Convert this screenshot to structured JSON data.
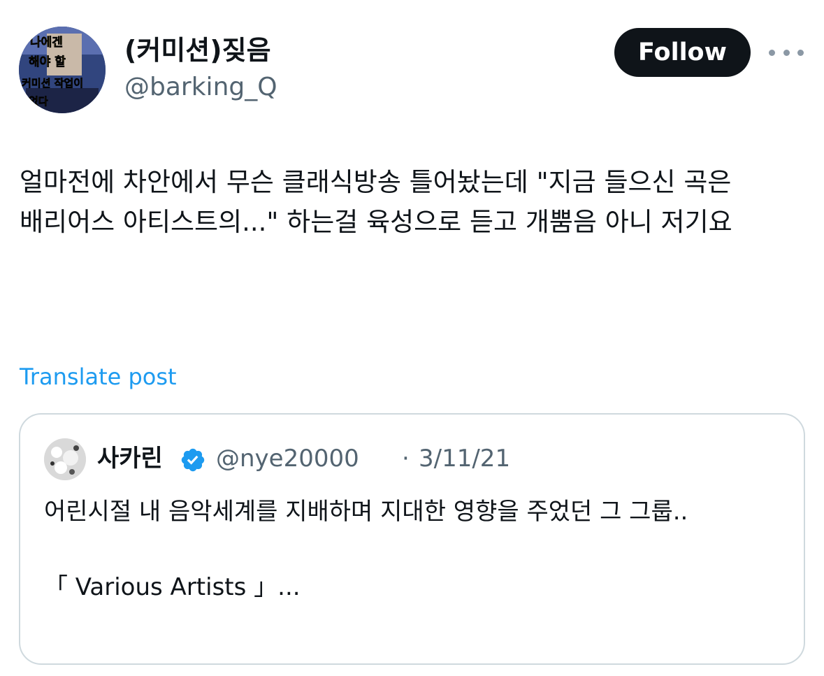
{
  "author": {
    "display_name": "(커미션)짖음",
    "handle": "@barking_Q",
    "avatar_text": [
      "나에겐",
      "해야 할",
      "커미션 작업이",
      "없다"
    ]
  },
  "follow_label": "Follow",
  "post": {
    "text": "얼마전에 차안에서 무슨 클래식방송 틀어놨는데 \"지금 들으신 곡은 배리어스 아티스트의...\" 하는걸 육성으로 듣고 개뿜음 아니 저기요"
  },
  "translate_label": "Translate post",
  "quote": {
    "display_name": "사카린",
    "handle": "@nye20000",
    "separator": "·",
    "date": "3/11/21",
    "text": "어린시절 내 음악세계를 지배하며 지대한 영향을 주었던 그 그룹..\n\n「 Various Artists 」..."
  },
  "colors": {
    "text": "#0f1419",
    "secondary": "#536471",
    "link": "#1d9bf0",
    "verified": "#1d9bf0",
    "follow_bg": "#0f1419",
    "border": "#cfd9de"
  },
  "icons": [
    "more-icon",
    "verified-badge-icon"
  ]
}
